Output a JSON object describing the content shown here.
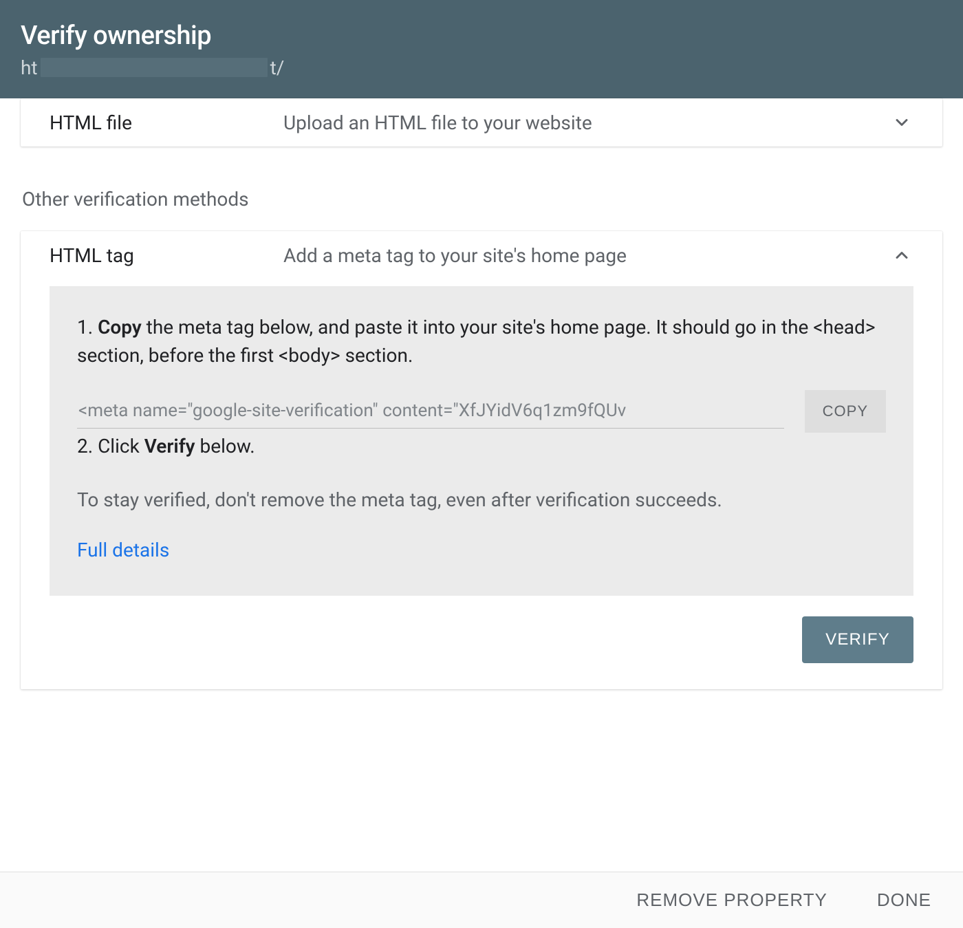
{
  "header": {
    "title": "Verify ownership",
    "urlPrefix": "ht",
    "urlSuffix": "t/"
  },
  "htmlFile": {
    "label": "HTML file",
    "desc": "Upload an HTML file to your website"
  },
  "sectionHeading": "Other verification methods",
  "htmlTag": {
    "label": "HTML tag",
    "desc": "Add a meta tag to your site's home page",
    "step1_num": "1. ",
    "step1_bold": "Copy",
    "step1_rest": " the meta tag below, and paste it into your site's home page. It should go in the <head> section, before the first <body> section.",
    "metaValue": "<meta name=\"google-site-verification\" content=\"XfJYidV6q1zm9fQUv",
    "copyLabel": "COPY",
    "step2_num": "2. Click ",
    "step2_bold": "Verify",
    "step2_rest": " below.",
    "note": "To stay verified, don't remove the meta tag, even after verification succeeds.",
    "fullDetails": "Full details",
    "verifyLabel": "VERIFY"
  },
  "footer": {
    "remove": "REMOVE PROPERTY",
    "done": "DONE"
  }
}
